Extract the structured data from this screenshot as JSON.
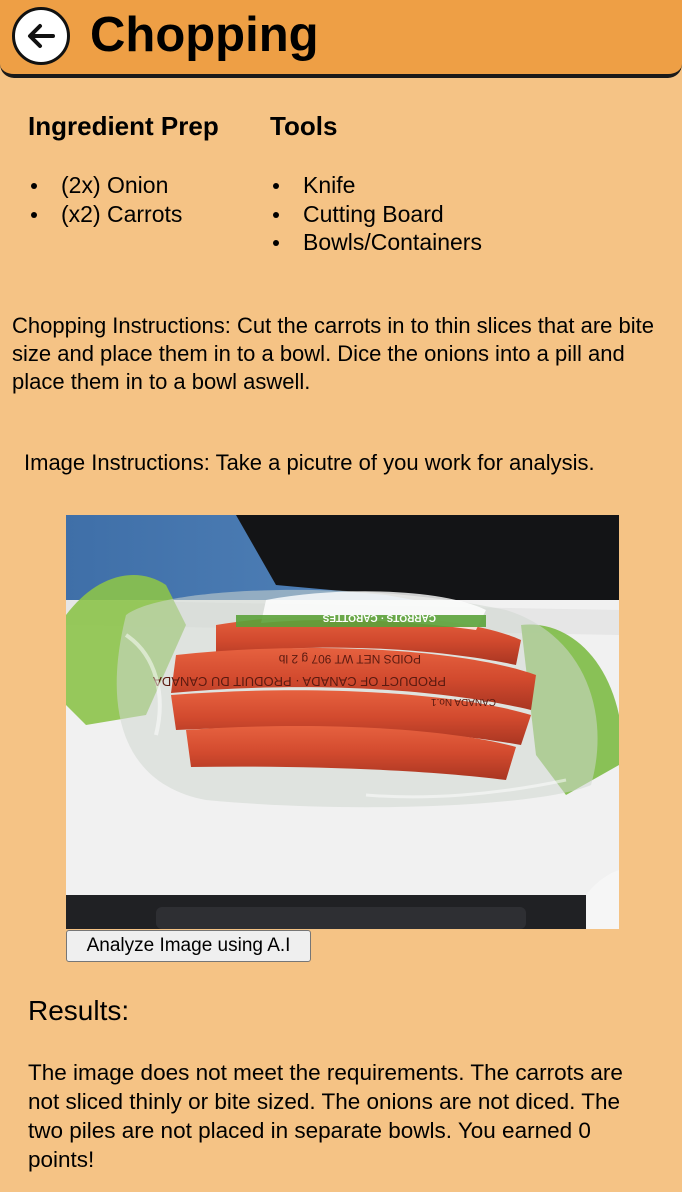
{
  "header": {
    "title": "Chopping",
    "back_icon": "arrow-left-circle-icon",
    "color": "#ee9f45"
  },
  "ingredients": {
    "heading": "Ingredient Prep",
    "items": [
      "(2x) Onion",
      "(x2) Carrots"
    ]
  },
  "tools": {
    "heading": "Tools",
    "items": [
      "Knife",
      "Cutting Board",
      "Bowls/Containers"
    ]
  },
  "chopping_instructions": "Chopping Instructions: Cut the carrots in to thin slices that are bite size and place them in to a bowl. Dice the onions into a pill and place them in to a bowl aswell.",
  "image_instructions": "Image Instructions: Take a picutre of you work for analysis.",
  "photo": {
    "bag_text_line1": "CARROTS · CAROTTES",
    "bag_text_line2": "POIDS NET WT 907 g 2 lb",
    "bag_text_line3": "PRODUCT OF CANADA · PRODUIT DU CANADA",
    "bag_text_line4": "CANADA No.1"
  },
  "analyze_button": "Analyze Image using A.I",
  "results": {
    "heading": "Results:",
    "text": "The image does not meet the requirements. The carrots are not sliced thinly or bite sized. The onions are not diced. The two piles are not placed in separate bowls. You earned 0 points!"
  },
  "colors": {
    "background": "#f5c385",
    "header": "#ee9f45"
  }
}
